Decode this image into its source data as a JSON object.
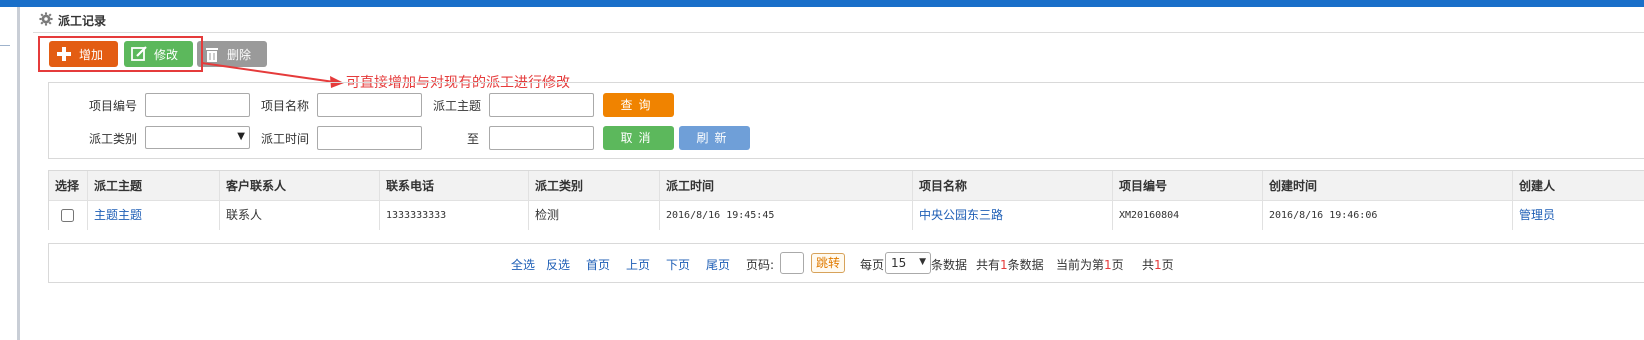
{
  "panel": {
    "title": "派工记录",
    "icon": "gear-icon"
  },
  "toolbar": {
    "add_label": "增加",
    "edit_label": "修改",
    "delete_label": "删除"
  },
  "annotation": {
    "text": "可直接增加与对现有的派工进行修改"
  },
  "search": {
    "project_no_label": "项目编号",
    "project_no_value": "",
    "project_name_label": "项目名称",
    "project_name_value": "",
    "subject_label": "派工主题",
    "subject_value": "",
    "type_label": "派工类别",
    "type_value": "",
    "time_label": "派工时间",
    "time_from_value": "",
    "to_label": "至",
    "time_to_value": "",
    "query_label": "查询",
    "cancel_label": "取消",
    "refresh_label": "刷新"
  },
  "table": {
    "headers": [
      "选择",
      "派工主题",
      "客户联系人",
      "联系电话",
      "派工类别",
      "派工时间",
      "项目名称",
      "项目编号",
      "创建时间",
      "创建人"
    ],
    "rows": [
      {
        "subject": "主题主题",
        "contact": "联系人",
        "phone": "1333333333",
        "type": "检测",
        "time": "2016/8/16 19:45:45",
        "project_name": "中央公园东三路",
        "project_no": "XM20160804",
        "created": "2016/8/16 19:46:06",
        "creator": "管理员"
      }
    ]
  },
  "pager": {
    "select_all": "全选",
    "invert": "反选",
    "first": "首页",
    "prev": "上页",
    "next": "下页",
    "last": "尾页",
    "page_label": "页码:",
    "jump": "跳转",
    "per_page_prefix": "每页",
    "per_page_value": "15",
    "per_page_suffix": "条数据",
    "total_prefix": "共有",
    "total_count": "1",
    "total_suffix": "条数据",
    "current_prefix": "当前为第",
    "current_page": "1",
    "current_suffix": "页",
    "pages_prefix": "共",
    "pages_count": "1",
    "pages_suffix": "页"
  },
  "colors": {
    "add": "#e35d13",
    "edit": "#5cb85c",
    "delete": "#9a9a9a",
    "query": "#f08300",
    "cancel": "#5cb85c",
    "refresh": "#6f9fd8",
    "accent": "#1a6fc9"
  }
}
